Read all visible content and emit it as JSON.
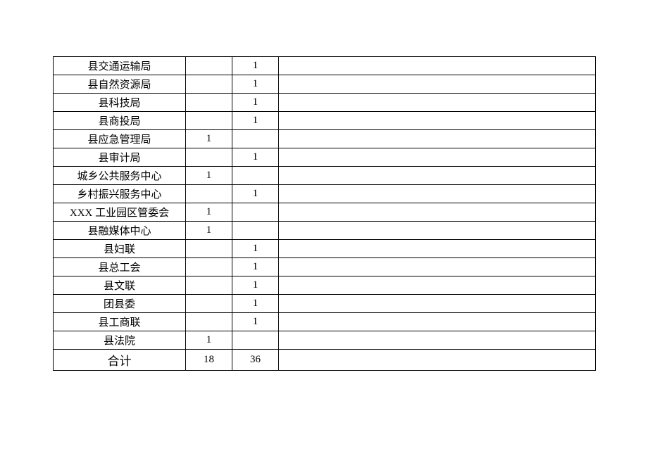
{
  "table": {
    "rows": [
      {
        "name": "县交通运输局",
        "col2": "",
        "col3": "1",
        "col4": ""
      },
      {
        "name": "县自然资源局",
        "col2": "",
        "col3": "1",
        "col4": ""
      },
      {
        "name": "县科技局",
        "col2": "",
        "col3": "1",
        "col4": ""
      },
      {
        "name": "县商投局",
        "col2": "",
        "col3": "1",
        "col4": ""
      },
      {
        "name": "县应急管理局",
        "col2": "1",
        "col3": "",
        "col4": ""
      },
      {
        "name": "县审计局",
        "col2": "",
        "col3": "1",
        "col4": ""
      },
      {
        "name": "城乡公共服务中心",
        "col2": "1",
        "col3": "",
        "col4": ""
      },
      {
        "name": "乡村振兴服务中心",
        "col2": "",
        "col3": "1",
        "col4": ""
      },
      {
        "name": "XXX 工业园区管委会",
        "col2": "1",
        "col3": "",
        "col4": ""
      },
      {
        "name": "县融媒体中心",
        "col2": "1",
        "col3": "",
        "col4": ""
      },
      {
        "name": "县妇联",
        "col2": "",
        "col3": "1",
        "col4": ""
      },
      {
        "name": "县总工会",
        "col2": "",
        "col3": "1",
        "col4": ""
      },
      {
        "name": "县文联",
        "col2": "",
        "col3": "1",
        "col4": ""
      },
      {
        "name": "团县委",
        "col2": "",
        "col3": "1",
        "col4": ""
      },
      {
        "name": "县工商联",
        "col2": "",
        "col3": "1",
        "col4": ""
      },
      {
        "name": "县法院",
        "col2": "1",
        "col3": "",
        "col4": ""
      }
    ],
    "total": {
      "label": "合计",
      "col2": "18",
      "col3": "36",
      "col4": ""
    }
  }
}
